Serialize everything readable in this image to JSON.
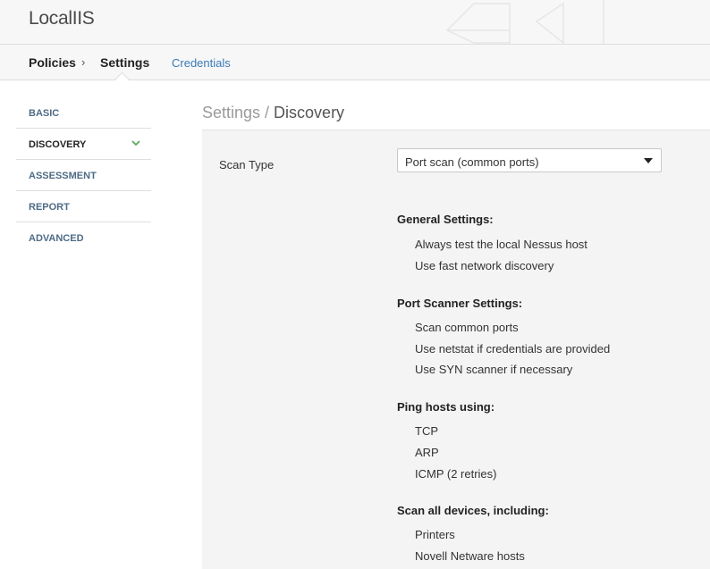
{
  "header": {
    "app_title": "LocalIIS"
  },
  "breadcrumb": {
    "policies": "Policies",
    "separator": "›",
    "settings": "Settings",
    "credentials": "Credentials"
  },
  "sidebar": {
    "items": [
      {
        "label": "BASIC"
      },
      {
        "label": "DISCOVERY",
        "active": true
      },
      {
        "label": "ASSESSMENT"
      },
      {
        "label": "REPORT"
      },
      {
        "label": "ADVANCED"
      }
    ]
  },
  "main": {
    "title_prefix": "Settings / ",
    "title_current": "Discovery",
    "scan_type": {
      "label": "Scan Type",
      "selected": "Port scan (common ports)"
    },
    "sections": [
      {
        "heading": "General Settings:",
        "items": [
          "Always test the local Nessus host",
          "Use fast network discovery"
        ]
      },
      {
        "heading": "Port Scanner Settings:",
        "items": [
          "Scan common ports",
          "Use netstat if credentials are provided",
          "Use SYN scanner if necessary"
        ]
      },
      {
        "heading": "Ping hosts using:",
        "items": [
          "TCP",
          "ARP",
          "ICMP (2 retries)"
        ]
      },
      {
        "heading": "Scan all devices, including:",
        "items": [
          "Printers",
          "Novell Netware hosts"
        ]
      }
    ]
  },
  "colors": {
    "link": "#3a7ab8",
    "chevron_active": "#5aab5a",
    "nav_text": "#4e6b86"
  }
}
